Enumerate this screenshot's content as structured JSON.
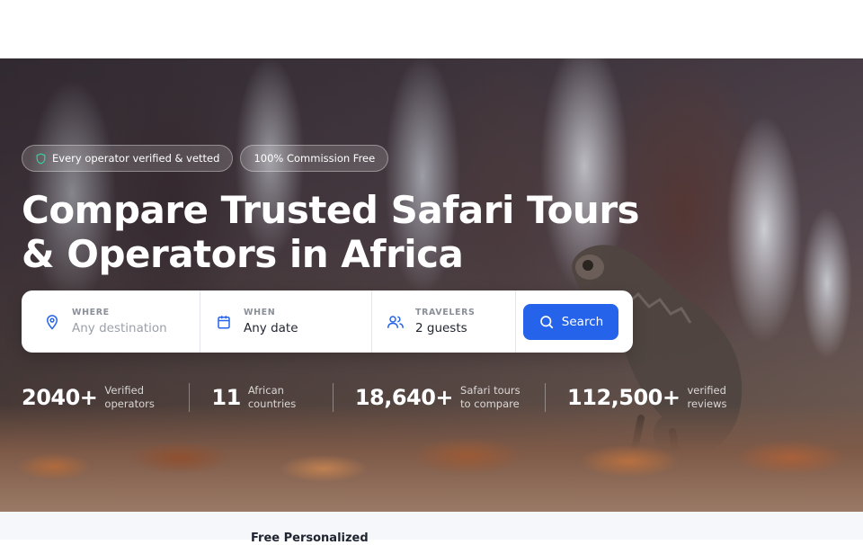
{
  "badges": [
    {
      "label": "Every operator verified & vetted",
      "icon": "shield-icon"
    },
    {
      "label": "100% Commission Free"
    }
  ],
  "headline": {
    "line1": "Compare Trusted Safari Tours",
    "line2": "& Operators in Africa"
  },
  "search": {
    "where": {
      "label": "WHERE",
      "value": "Any destination",
      "icon": "map-pin-icon"
    },
    "when": {
      "label": "WHEN",
      "value": "Any date",
      "icon": "calendar-icon"
    },
    "travelers": {
      "label": "TRAVELERS",
      "value": "2 guests",
      "icon": "users-icon"
    },
    "button_label": "Search",
    "button_color": "#2563eb"
  },
  "stats": [
    {
      "number": "2040+",
      "line1": "Verified",
      "line2": "operators"
    },
    {
      "number": "11",
      "line1": "African",
      "line2": "countries"
    },
    {
      "number": "18,640+",
      "line1": "Safari tours",
      "line2": "to compare"
    },
    {
      "number": "112,500+",
      "line1": "verified",
      "line2": "reviews"
    }
  ],
  "below": {
    "teaser": "Free Personalized"
  }
}
